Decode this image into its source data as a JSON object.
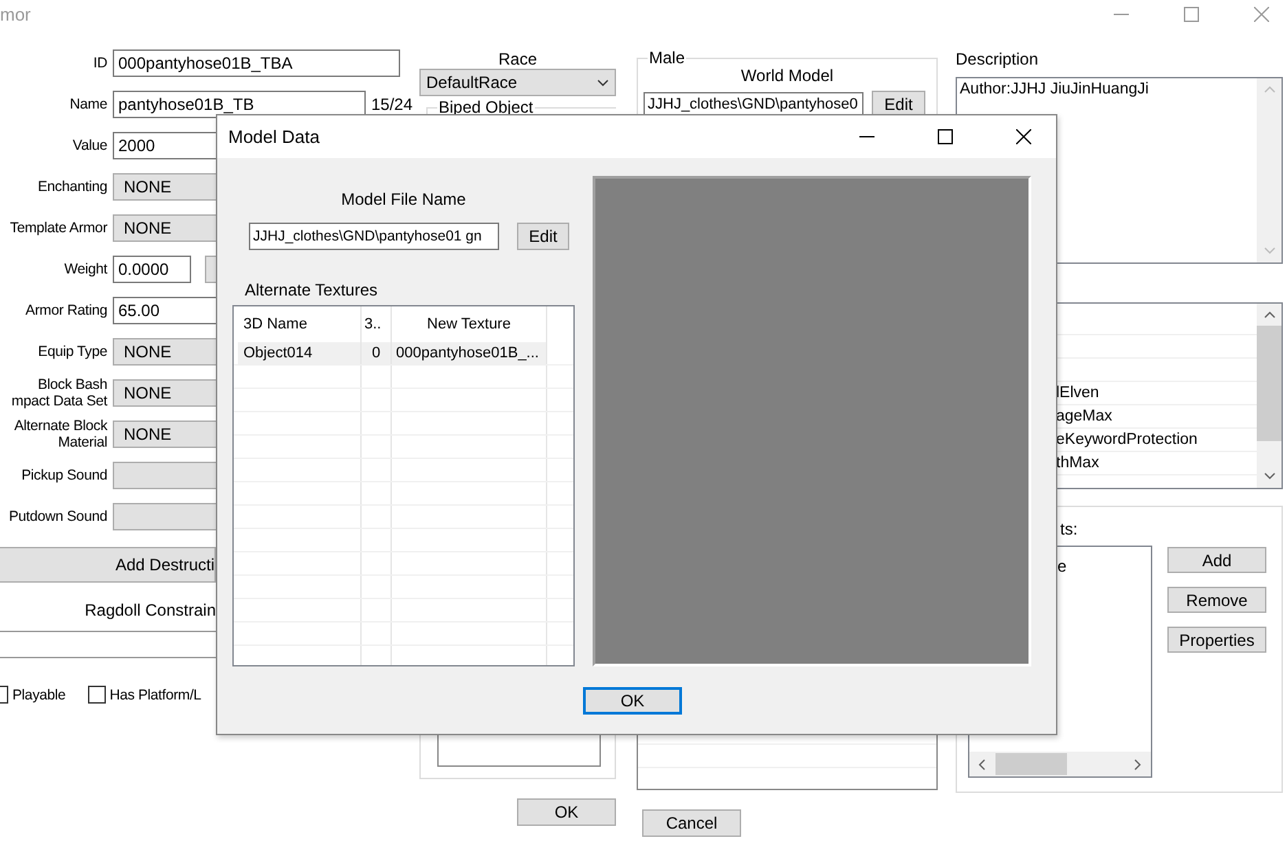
{
  "window": {
    "title": "mor"
  },
  "fields": [
    {
      "label": [
        "ID"
      ],
      "kind": "text",
      "value": "000pantyhose01B_TBA"
    },
    {
      "label": [
        "Name"
      ],
      "kind": "text",
      "value": "pantyhose01B_TB",
      "counter": "15/24"
    },
    {
      "label": [
        "Value"
      ],
      "kind": "text",
      "value": "2000"
    },
    {
      "label": [
        "Enchanting"
      ],
      "kind": "dropdown",
      "value": "NONE"
    },
    {
      "label": [
        "Template Armor"
      ],
      "kind": "dropdown",
      "value": "NONE"
    },
    {
      "label": [
        "Weight"
      ],
      "kind": "short",
      "value": "0.0000"
    },
    {
      "label": [
        "Armor Rating"
      ],
      "kind": "text",
      "value": "65.00"
    },
    {
      "label": [
        "Equip Type"
      ],
      "kind": "dropdown",
      "value": "NONE"
    },
    {
      "label": [
        "Block Bash",
        "mpact Data Set"
      ],
      "kind": "dropdown",
      "value": "NONE"
    },
    {
      "label": [
        "Alternate Block",
        "Material"
      ],
      "kind": "dropdown",
      "value": "NONE"
    },
    {
      "label": [
        "Pickup Sound"
      ],
      "kind": "sound"
    },
    {
      "label": [
        "Putdown Sound"
      ],
      "kind": "sound"
    }
  ],
  "destruction_button": "Add Destructi",
  "ragdoll_button": "Ragdoll Constrain",
  "checkboxes": [
    {
      "label": "Playable",
      "checked": false
    },
    {
      "label": "Has Platform/L",
      "checked": false
    }
  ],
  "race": {
    "label": "Race",
    "value": "DefaultRace"
  },
  "biped_object": {
    "label": "Biped Object"
  },
  "male": {
    "label": "Male",
    "world_model_label": "World Model",
    "world_model_value": "JJHJ_clothes\\GND\\pantyhose0",
    "edit_button": "Edit"
  },
  "description": {
    "label": "Description",
    "value": "Author:JJHJ JiuJinHuangJi"
  },
  "keywords": [
    "lElven",
    "ageMax",
    "eKeywordProtection",
    "thMax"
  ],
  "scripts": {
    "label": "ts:",
    "items": [
      "e"
    ],
    "buttons": [
      "Add",
      "Remove",
      "Properties"
    ]
  },
  "footer_buttons": [
    "OK",
    "Cancel"
  ],
  "dialog": {
    "title": "Model Data",
    "model_file_label": "Model File Name",
    "model_file_value": "JJHJ_clothes\\GND\\pantyhose01 gn",
    "edit_button": "Edit",
    "textures_label": "Alternate Textures",
    "columns": [
      "3D Name",
      "3..",
      "New Texture"
    ],
    "rows": [
      {
        "cells": [
          "Object014",
          "0",
          "000pantyhose01B_..."
        ],
        "selected": true
      }
    ],
    "ok_button": "OK"
  }
}
